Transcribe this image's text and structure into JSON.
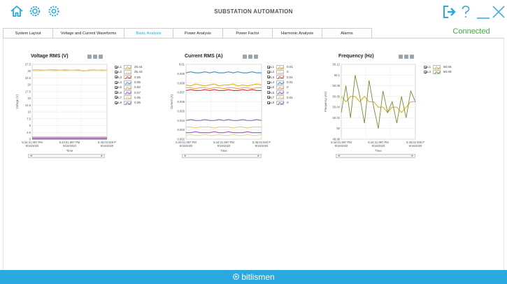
{
  "header": {
    "title": "SUBSTATION AUTOMATION",
    "status": "Connected",
    "accent": "#29a9df",
    "status_color": "#3dae3d",
    "left_icons": [
      "home-icon",
      "settings-alt-icon",
      "settings-icon"
    ],
    "right_icons": [
      "logout-icon",
      "help-icon",
      "minimize-icon",
      "close-icon"
    ]
  },
  "tabs": [
    {
      "label": "System Layout",
      "active": false
    },
    {
      "label": "Voltage and Current Waveforms",
      "active": false
    },
    {
      "label": "Basic Analysis",
      "active": true
    },
    {
      "label": "Power Analysis",
      "active": false
    },
    {
      "label": "Power Factor",
      "active": false
    },
    {
      "label": "Harmonic Analysis",
      "active": false
    },
    {
      "label": "Alarms",
      "active": false
    }
  ],
  "footer": {
    "brand": "bitlismen"
  },
  "charts": [
    {
      "title": "Voltage RMS (V)",
      "ylabel": "Voltage (V)",
      "xlabel": "Time",
      "yticks": [
        "27.5",
        "25",
        "22.5",
        "20",
        "17.5",
        "15",
        "12.5",
        "10",
        "7.5",
        "5",
        "2.5",
        "0"
      ],
      "xticks": [
        [
          "5:44:31.997 PM",
          "9/16/2020"
        ],
        [
          "5:44:51.997 PM",
          "9/16/2020"
        ],
        [
          "5:45:03.929 P",
          "9/16/2020"
        ]
      ],
      "legend": [
        {
          "name": "L1",
          "value": "25.44",
          "color": "#e3b21f"
        },
        {
          "name": "L2",
          "value": "25.43",
          "color": "#e8d7a0"
        },
        {
          "name": "L3",
          "value": "0.06",
          "color": "#d9323a"
        },
        {
          "name": "L4",
          "value": "0.05",
          "color": "#4b8fd1"
        },
        {
          "name": "L5",
          "value": "0.82",
          "color": "#f2a55a"
        },
        {
          "name": "L6",
          "value": "0.47",
          "color": "#b04ad0"
        },
        {
          "name": "L7",
          "value": "0.05",
          "color": "#d7d37a"
        },
        {
          "name": "L8",
          "value": "0.06",
          "color": "#6e64c8"
        }
      ]
    },
    {
      "title": "Current RMS (A)",
      "ylabel": "Current (A)",
      "xlabel": "Time",
      "yticks": [
        "0.01",
        "0.009",
        "0.008",
        "0.007",
        "0.006",
        "0.005",
        "0.004",
        "0.003",
        "0.002"
      ],
      "xticks": [
        [
          "5:44:01.997 PM",
          "9/16/2020"
        ],
        [
          "5:44:31.997 PM",
          "9/16/2020"
        ],
        [
          "5:45:03.840 P",
          "9/16/2020"
        ]
      ],
      "legend": [
        {
          "name": "L1",
          "value": "0.01",
          "color": "#e3b21f"
        },
        {
          "name": "L2",
          "value": "0",
          "color": "#e8d7a0"
        },
        {
          "name": "L3",
          "value": "0.01",
          "color": "#d9323a"
        },
        {
          "name": "L4",
          "value": "0.01",
          "color": "#2f8fcf"
        },
        {
          "name": "L5",
          "value": "0",
          "color": "#f2a55a"
        },
        {
          "name": "L6",
          "value": "0",
          "color": "#b04ad0"
        },
        {
          "name": "L7",
          "value": "0.01",
          "color": "#d7d37a"
        },
        {
          "name": "L8",
          "value": "0",
          "color": "#6e64c8"
        }
      ]
    },
    {
      "title": "Frequency (Hz)",
      "ylabel": "Frequency (Hz)",
      "xlabel": "Time",
      "yticks": [
        "50.12",
        "50.1",
        "50.08",
        "50.06",
        "50.04",
        "50.02",
        "50",
        "49.98"
      ],
      "xticks": [
        [
          "5:44:01.997 PM",
          "9/16/2020"
        ],
        [
          "5:44:31.997 PM",
          "9/16/2020"
        ],
        [
          "5:45:02.935 P",
          "9/16/2020"
        ]
      ],
      "legend": [
        {
          "name": "L1",
          "value": "50.05",
          "color": "#e3b21f"
        },
        {
          "name": "L4",
          "value": "50.05",
          "color": "#6f8f2c"
        }
      ]
    }
  ],
  "chart_data": [
    {
      "type": "line",
      "title": "Voltage RMS (V)",
      "ylabel": "Voltage (V)",
      "xlabel": "Time",
      "ylim": [
        0,
        27.5
      ],
      "grid": true,
      "series": [
        {
          "name": "L1",
          "values": [
            25.4,
            25.5,
            25.4,
            25.4,
            25.5,
            25.5,
            25.4,
            25.5,
            25.4,
            25.4,
            25.5,
            25.0,
            25.4,
            25.5,
            25.4,
            25.4,
            25.4
          ]
        },
        {
          "name": "L2",
          "values": [
            25.2,
            25.3,
            25.2,
            25.3,
            25.3,
            25.2,
            25.3,
            25.2,
            25.3,
            25.3,
            25.2,
            25.3,
            25.2,
            25.3,
            25.3,
            25.2,
            25.3
          ]
        },
        {
          "name": "L3",
          "values": [
            0.06,
            0.06,
            0.06,
            0.06,
            0.06,
            0.06,
            0.06,
            0.06,
            0.06,
            0.06,
            0.06,
            0.06,
            0.06,
            0.06,
            0.06,
            0.06,
            0.06
          ]
        },
        {
          "name": "L4",
          "values": [
            0.05,
            0.05,
            0.05,
            0.05,
            0.05,
            0.05,
            0.05,
            0.05,
            0.05,
            0.05,
            0.05,
            0.05,
            0.05,
            0.05,
            0.05,
            0.05,
            0.05
          ]
        },
        {
          "name": "L5",
          "values": [
            0.82,
            0.82,
            0.82,
            0.82,
            0.82,
            0.82,
            0.82,
            0.82,
            0.82,
            0.82,
            0.82,
            0.82,
            0.82,
            0.82,
            0.82,
            0.82,
            0.82
          ]
        },
        {
          "name": "L6",
          "values": [
            0.47,
            0.47,
            0.47,
            0.47,
            0.47,
            0.47,
            0.47,
            0.47,
            0.47,
            0.47,
            0.47,
            0.47,
            0.47,
            0.47,
            0.47,
            0.47,
            0.47
          ]
        },
        {
          "name": "L7",
          "values": [
            0.05,
            0.05,
            0.05,
            0.05,
            0.05,
            0.05,
            0.05,
            0.05,
            0.05,
            0.05,
            0.05,
            0.05,
            0.05,
            0.05,
            0.05,
            0.05,
            0.05
          ]
        },
        {
          "name": "L8",
          "values": [
            0.06,
            0.06,
            0.06,
            0.06,
            0.06,
            0.06,
            0.06,
            0.06,
            0.06,
            0.06,
            0.06,
            0.06,
            0.06,
            0.06,
            0.06,
            0.06,
            0.06
          ]
        }
      ]
    },
    {
      "type": "line",
      "title": "Current RMS (A)",
      "ylabel": "Current (A)",
      "xlabel": "Time",
      "ylim": [
        0.002,
        0.01
      ],
      "grid": true,
      "series": [
        {
          "name": "L1",
          "values": [
            0.0078,
            0.0077,
            0.0079,
            0.0078,
            0.0077,
            0.0078,
            0.0079,
            0.0077,
            0.0078,
            0.0078,
            0.0079,
            0.0077,
            0.0078,
            0.0077,
            0.0078,
            0.0079,
            0.0078
          ]
        },
        {
          "name": "L2",
          "values": [
            0.0024,
            0.0025,
            0.0024,
            0.0024,
            0.0025,
            0.0024,
            0.0024,
            0.0025,
            0.0024,
            0.0024,
            0.0025,
            0.0024,
            0.0024,
            0.0025,
            0.0024,
            0.0024,
            0.0025
          ]
        },
        {
          "name": "L3",
          "values": [
            0.0072,
            0.0073,
            0.0072,
            0.0072,
            0.0073,
            0.0072,
            0.0073,
            0.0072,
            0.0072,
            0.0073,
            0.0072,
            0.0072,
            0.0073,
            0.0072,
            0.0073,
            0.0072,
            0.0072
          ]
        },
        {
          "name": "L4",
          "values": [
            0.0091,
            0.0092,
            0.0091,
            0.0091,
            0.0092,
            0.0091,
            0.0092,
            0.0091,
            0.0091,
            0.0092,
            0.0091,
            0.0092,
            0.0091,
            0.0091,
            0.0092,
            0.0091,
            0.0091
          ]
        },
        {
          "name": "L5",
          "values": [
            0.0075,
            0.0075,
            0.0074,
            0.0075,
            0.0075,
            0.0074,
            0.0075,
            0.0075,
            0.0074,
            0.0075,
            0.0075,
            0.0074,
            0.0075,
            0.0075,
            0.0074,
            0.0075,
            0.0075
          ]
        },
        {
          "name": "L6",
          "values": [
            0.0027,
            0.0027,
            0.0028,
            0.0027,
            0.0027,
            0.0027,
            0.0028,
            0.0027,
            0.0027,
            0.0028,
            0.0027,
            0.0027,
            0.0027,
            0.0028,
            0.0027,
            0.0027,
            0.0027
          ]
        },
        {
          "name": "L7",
          "values": [
            0.0033,
            0.0033,
            0.0032,
            0.0033,
            0.0033,
            0.0033,
            0.0032,
            0.0033,
            0.0033,
            0.0033,
            0.0032,
            0.0033,
            0.0033,
            0.0032,
            0.0033,
            0.0033,
            0.0033
          ]
        },
        {
          "name": "L8",
          "values": [
            0.004,
            0.0041,
            0.004,
            0.004,
            0.0041,
            0.004,
            0.004,
            0.0041,
            0.004,
            0.0041,
            0.004,
            0.004,
            0.0041,
            0.004,
            0.004,
            0.0041,
            0.004
          ]
        }
      ]
    },
    {
      "type": "line",
      "title": "Frequency (Hz)",
      "ylabel": "Frequency (Hz)",
      "xlabel": "Time",
      "ylim": [
        49.98,
        50.12
      ],
      "grid": true,
      "series": [
        {
          "name": "L1",
          "values": [
            50.06,
            50.05,
            50.06,
            50.06,
            50.05,
            50.06,
            50.05,
            50.05,
            50.04,
            50.04,
            50.03,
            50.04,
            50.04,
            50.03,
            50.04,
            50.05,
            50.05
          ]
        },
        {
          "name": "L4",
          "values": [
            50.03,
            50.08,
            50.02,
            50.1,
            50.06,
            50.01,
            50.09,
            50.04,
            50.0,
            50.07,
            50.03,
            50.05,
            50.01,
            50.06,
            50.02,
            50.07,
            50.05
          ]
        }
      ]
    }
  ]
}
